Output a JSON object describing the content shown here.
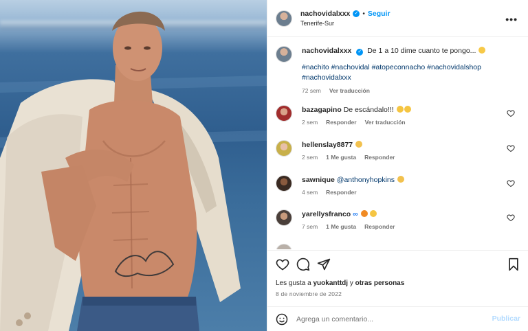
{
  "post": {
    "username": "nachovidalxxx",
    "follow_label": "Seguir",
    "separator": "•",
    "location": "Tenerife-Sur",
    "more_label": "•••"
  },
  "caption": {
    "username": "nachovidalxxx",
    "text": "De 1 a 10 dime cuanto te pongo...",
    "hashtags": "#nachito #nachovidal #atopeconnacho #nachovidalshop #nachovidalxxx",
    "time": "72 sem",
    "translate": "Ver traducción"
  },
  "comments": [
    {
      "username": "bazagapino",
      "text": "De escándalo!!!",
      "time": "2 sem",
      "reply": "Responder",
      "translate": "Ver traducción",
      "likes": ""
    },
    {
      "username": "hellenslay8877",
      "text": "",
      "time": "2 sem",
      "likes": "1 Me gusta",
      "reply": "Responder",
      "translate": ""
    },
    {
      "username": "sawnique",
      "mention": "@anthonyhopkins",
      "text": "",
      "time": "4 sem",
      "reply": "Responder",
      "likes": "",
      "translate": ""
    },
    {
      "username": "yarellysfranco",
      "text": "",
      "time": "7 sem",
      "likes": "1 Me gusta",
      "reply": "Responder",
      "translate": ""
    }
  ],
  "actions": {
    "likes_prefix": "Les gusta a ",
    "likes_user": "yuokanttdj",
    "likes_middle": " y ",
    "likes_others": "otras personas",
    "date": "8 de noviembre de 2022"
  },
  "composer": {
    "placeholder": "Agrega un comentario...",
    "publish_label": "Publicar"
  },
  "colors": {
    "accent": "#0095f6",
    "link": "#00376b",
    "muted": "#737373"
  }
}
